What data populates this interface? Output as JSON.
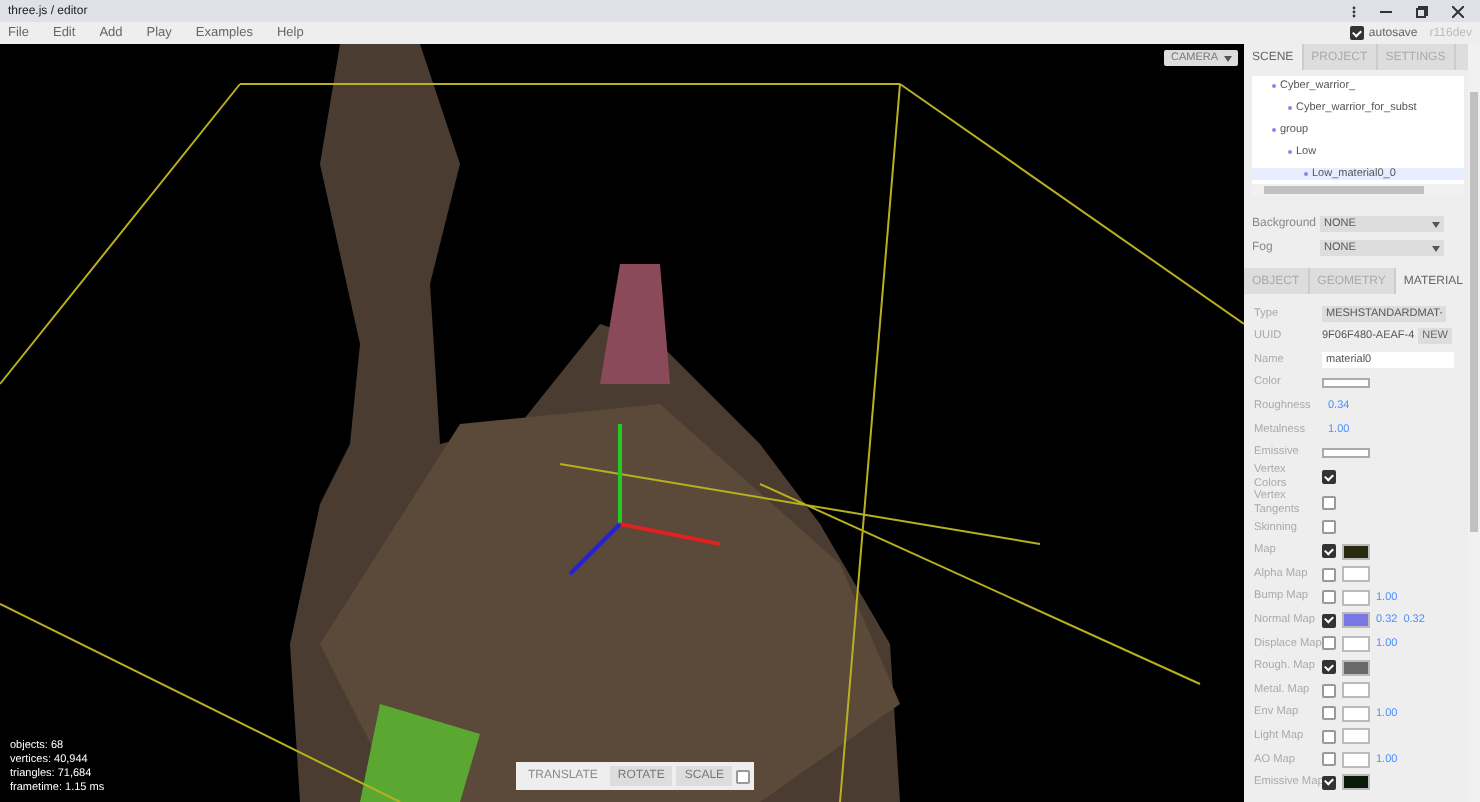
{
  "window": {
    "title": "three.js / editor"
  },
  "menu": [
    {
      "label": "File"
    },
    {
      "label": "Edit"
    },
    {
      "label": "Add"
    },
    {
      "label": "Play"
    },
    {
      "label": "Examples"
    },
    {
      "label": "Help"
    }
  ],
  "autosave": {
    "label": "autosave",
    "checked": true
  },
  "version": "r116dev",
  "viewport": {
    "camera": "CAMERA",
    "info": [
      "objects: 68",
      "vertices: 40,944",
      "triangles: 71,684",
      "frametime: 1.15 ms"
    ],
    "tools": [
      {
        "label": "TRANSLATE",
        "selected": true
      },
      {
        "label": "ROTATE",
        "selected": false
      },
      {
        "label": "SCALE",
        "selected": false
      }
    ],
    "local": {
      "checked": false
    }
  },
  "sidebar": {
    "tabs": [
      {
        "label": "SCENE",
        "selected": true
      },
      {
        "label": "PROJECT",
        "selected": false
      },
      {
        "label": "SETTINGS",
        "selected": false
      }
    ],
    "outliner": [
      {
        "label": "Cyber_warrior_",
        "selected": false,
        "children": [
          {
            "label": "Cyber_warrior_for_subst",
            "selected": false
          }
        ]
      },
      {
        "label": "group",
        "selected": false,
        "children": [
          {
            "label": "Low",
            "selected": false,
            "children": [
              {
                "label": "Low_material0_0",
                "selected": true
              }
            ]
          }
        ]
      }
    ],
    "scene_props": [
      {
        "label": "Background",
        "value": "NONE"
      },
      {
        "label": "Fog",
        "value": "NONE"
      }
    ],
    "object_tabs": [
      {
        "label": "OBJECT",
        "selected": false
      },
      {
        "label": "GEOMETRY",
        "selected": false
      },
      {
        "label": "MATERIAL",
        "selected": true
      }
    ],
    "material": [
      {
        "kind": "select",
        "label": "Type",
        "value": "MESHSTANDARDMAT"
      },
      {
        "kind": "uuid",
        "label": "UUID",
        "value": "9F06F480-AEAF-4",
        "button": "NEW"
      },
      {
        "kind": "input",
        "label": "Name",
        "value": "material0"
      },
      {
        "kind": "color",
        "label": "Color",
        "color": "#ffffff"
      },
      {
        "kind": "number",
        "label": "Roughness",
        "value": "0.34"
      },
      {
        "kind": "number",
        "label": "Metalness",
        "value": "1.00"
      },
      {
        "kind": "color",
        "label": "Emissive",
        "color": "#ffffff"
      },
      {
        "kind": "checkbox",
        "label": "Vertex Colors",
        "checked": true
      },
      {
        "kind": "checkbox",
        "label": "Vertex Tangents",
        "checked": false
      },
      {
        "kind": "checkbox",
        "label": "Skinning",
        "checked": false
      },
      {
        "kind": "map",
        "label": "Map",
        "checked": true,
        "color": "#2a2a10"
      },
      {
        "kind": "map",
        "label": "Alpha Map",
        "checked": false
      },
      {
        "kind": "map",
        "label": "Bump Map",
        "checked": false,
        "values": [
          "1.00"
        ]
      },
      {
        "kind": "map",
        "label": "Normal Map",
        "checked": true,
        "color": "#7b78e6",
        "values": [
          "0.32",
          "0.32"
        ]
      },
      {
        "kind": "map",
        "label": "Displace Map",
        "checked": false,
        "values": [
          "1.00"
        ]
      },
      {
        "kind": "map",
        "label": "Rough. Map",
        "checked": true,
        "color": "#6a6a6a"
      },
      {
        "kind": "map",
        "label": "Metal. Map",
        "checked": false
      },
      {
        "kind": "map",
        "label": "Env Map",
        "checked": false,
        "values": [
          "1.00"
        ]
      },
      {
        "kind": "map",
        "label": "Light Map",
        "checked": false
      },
      {
        "kind": "map",
        "label": "AO Map",
        "checked": false,
        "values": [
          "1.00"
        ]
      },
      {
        "kind": "map",
        "label": "Emissive Map",
        "checked": true,
        "color": "#0c1a0c"
      }
    ]
  }
}
